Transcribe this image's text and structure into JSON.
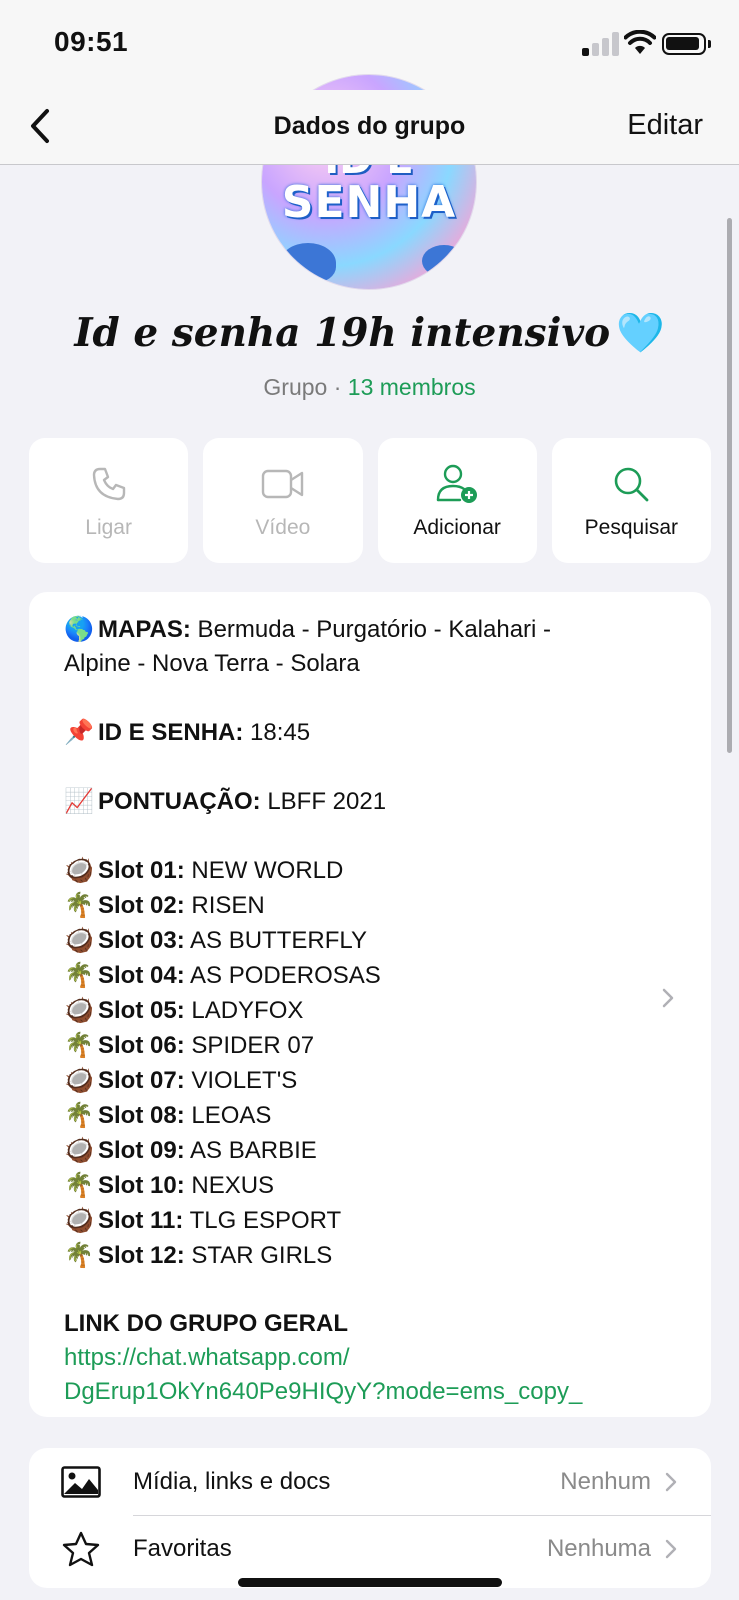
{
  "status_bar": {
    "time": "09:51",
    "signal_bars_on": 1,
    "signal_bars_total": 4,
    "battery_percent": 85
  },
  "nav": {
    "title": "Dados do grupo",
    "edit_label": "Editar"
  },
  "avatar": {
    "text_top": "ID E",
    "text_main": "SENHA"
  },
  "group": {
    "name": "Id e senha 19h intensivo",
    "heart": "🩵",
    "type": "Grupo",
    "separator": " · ",
    "members": "13 membros"
  },
  "actions": [
    {
      "label": "Ligar",
      "icon": "phone-icon",
      "enabled": false
    },
    {
      "label": "Vídeo",
      "icon": "video-camera-icon",
      "enabled": false
    },
    {
      "label": "Adicionar",
      "icon": "add-person-icon",
      "enabled": true
    },
    {
      "label": "Pesquisar",
      "icon": "search-icon",
      "enabled": true
    }
  ],
  "description": {
    "maps_emoji": "🌎",
    "maps_label": "MAPAS:",
    "maps_value": " Bermuda - Purgatório - Kalahari  -",
    "maps_value2": "Alpine - Nova Terra - Solara",
    "id_emoji": "📌",
    "id_label": "ID E SENHA:",
    "id_value": " 18:45",
    "score_emoji": "📈",
    "score_label": "PONTUAÇÃO:",
    "score_value": " LBFF 2021",
    "slots": [
      {
        "emoji": "🥥",
        "label": "Slot 01:",
        "value": " NEW WORLD"
      },
      {
        "emoji": "🌴",
        "label": "Slot 02:",
        "value": " RISEN"
      },
      {
        "emoji": "🥥",
        "label": "Slot 03:",
        "value": " AS BUTTERFLY"
      },
      {
        "emoji": "🌴",
        "label": "Slot 04:",
        "value": " AS PODEROSAS"
      },
      {
        "emoji": "🥥",
        "label": "Slot 05:",
        "value": " LADYFOX"
      },
      {
        "emoji": "🌴",
        "label": "Slot 06:",
        "value": " SPIDER 07"
      },
      {
        "emoji": "🥥",
        "label": "Slot 07:",
        "value": " VIOLET'S"
      },
      {
        "emoji": "🌴",
        "label": "Slot 08:",
        "value": " LEOAS"
      },
      {
        "emoji": "🥥",
        "label": "Slot 09:",
        "value": " AS BARBIE"
      },
      {
        "emoji": "🌴",
        "label": "Slot 10:",
        "value": " NEXUS"
      },
      {
        "emoji": "🥥",
        "label": "Slot 11:",
        "value": " TLG ESPORT"
      },
      {
        "emoji": "🌴",
        "label": "Slot 12:",
        "value": " STAR GIRLS"
      }
    ],
    "link_title": "LINK DO GRUPO GERAL",
    "link_line1": "https://chat.whatsapp.com/",
    "link_line2": "DgErup1OkYn640Pe9HIQyY?mode=ems_copy_"
  },
  "list": [
    {
      "label": "Mídia, links e docs",
      "value": "Nenhum",
      "icon": "image-icon"
    },
    {
      "label": "Favoritas",
      "value": "Nenhuma",
      "icon": "star-icon"
    }
  ],
  "colors": {
    "accent_green": "#1d9c57",
    "background": "#f2f2f7",
    "card": "#ffffff",
    "disabled": "#b7b7b7"
  }
}
